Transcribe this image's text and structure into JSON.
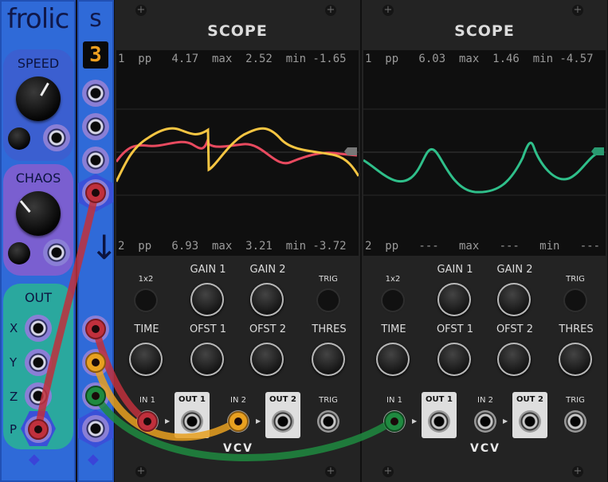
{
  "frolic": {
    "title": "frolic",
    "speed_label": "SPEED",
    "chaos_label": "CHAOS",
    "out_label": "OUT",
    "out_x": "X",
    "out_y": "Y",
    "out_z": "Z",
    "out_p": "P"
  },
  "s_module": {
    "title": "s",
    "display_value": "3"
  },
  "scopes": [
    {
      "title": "SCOPE",
      "stat1": "1  pp   4.17  max  2.52  min -1.65",
      "stat2": "2  pp   6.93  max  3.21  min -3.72",
      "labels": {
        "x1x2": "1x2",
        "gain1": "GAIN 1",
        "gain2": "GAIN 2",
        "trig": "TRIG",
        "time": "TIME",
        "ofst1": "OFST 1",
        "ofst2": "OFST 2",
        "thres": "THRES",
        "in1": "IN 1",
        "out1": "OUT 1",
        "in2": "IN 2",
        "out2": "OUT 2",
        "trig_in": "TRIG",
        "brand": "VCV"
      }
    },
    {
      "title": "SCOPE",
      "stat1": "1  pp   6.03  max  1.46  min -4.57",
      "stat2": "2  pp   ---   max   ---   min   ---",
      "labels": {
        "x1x2": "1x2",
        "gain1": "GAIN 1",
        "gain2": "GAIN 2",
        "trig": "TRIG",
        "time": "TIME",
        "ofst1": "OFST 1",
        "ofst2": "OFST 2",
        "thres": "THRES",
        "in1": "IN 1",
        "out1": "OUT 1",
        "in2": "IN 2",
        "out2": "OUT 2",
        "trig_in": "TRIG",
        "brand": "VCV"
      }
    }
  ],
  "colors": {
    "trace_red": "#e84a5f",
    "trace_yellow": "#f5c542",
    "trace_green": "#2fbf8a",
    "cable_red": "#c0303c",
    "cable_orange": "#e8a020",
    "cable_green": "#1f8a40"
  }
}
